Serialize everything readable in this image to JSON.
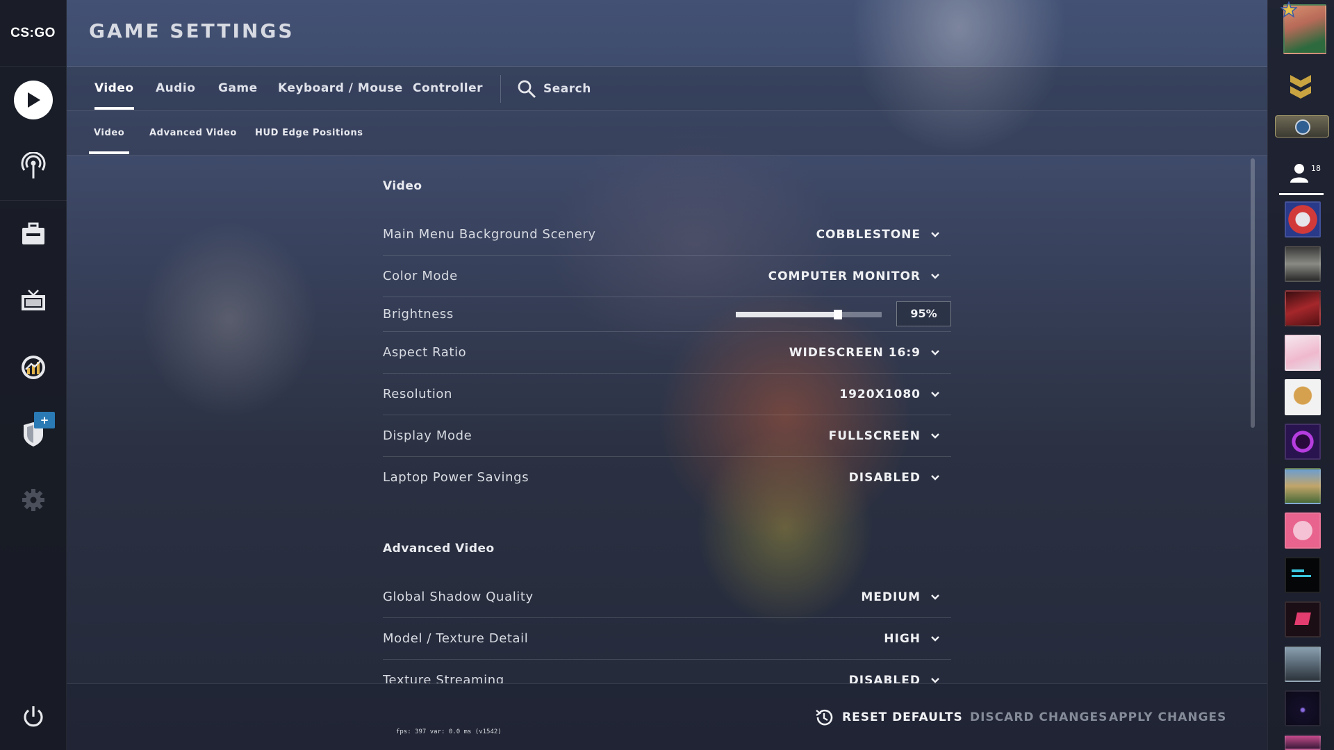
{
  "app": {
    "logo_text": "CS:GO",
    "page_title": "GAME SETTINGS"
  },
  "tabs": [
    {
      "label": "Video",
      "active": true
    },
    {
      "label": "Audio",
      "active": false
    },
    {
      "label": "Game",
      "active": false
    },
    {
      "label": "Keyboard / Mouse",
      "active": false
    },
    {
      "label": "Controller",
      "active": false
    }
  ],
  "search": {
    "label": "Search"
  },
  "subtabs": [
    {
      "label": "Video",
      "active": true
    },
    {
      "label": "Advanced Video",
      "active": false
    },
    {
      "label": "HUD Edge Positions",
      "active": false
    }
  ],
  "sections": {
    "video_title": "Video",
    "advanced_title": "Advanced Video"
  },
  "settings": {
    "background_scenery": {
      "label": "Main Menu Background Scenery",
      "value": "COBBLESTONE"
    },
    "color_mode": {
      "label": "Color Mode",
      "value": "COMPUTER MONITOR"
    },
    "brightness": {
      "label": "Brightness",
      "value": "95%",
      "slider_level": 0.7
    },
    "aspect_ratio": {
      "label": "Aspect Ratio",
      "value": "WIDESCREEN 16:9"
    },
    "resolution": {
      "label": "Resolution",
      "value": "1920X1080"
    },
    "display_mode": {
      "label": "Display Mode",
      "value": "FULLSCREEN"
    },
    "power_savings": {
      "label": "Laptop Power Savings",
      "value": "DISABLED"
    },
    "shadow_quality": {
      "label": "Global Shadow Quality",
      "value": "MEDIUM"
    },
    "texture_detail": {
      "label": "Model / Texture Detail",
      "value": "HIGH"
    },
    "texture_streaming": {
      "label": "Texture Streaming",
      "value": "DISABLED"
    }
  },
  "bottom": {
    "reset": "RESET DEFAULTS",
    "discard": "DISCARD CHANGES",
    "apply": "APPLY CHANGES",
    "fps_text": "fps:   397 var:  0.0 ms (v1542)"
  },
  "friends": {
    "count": "18"
  },
  "nav_left": {
    "icons": [
      "play-icon",
      "broadcast-icon",
      "inventory-icon",
      "tv-icon",
      "stats-icon",
      "shield-icon",
      "gear-icon",
      "power-icon"
    ],
    "badge": "+"
  },
  "colors": {
    "accent": "#ffffff",
    "badge_blue": "#2a7ab5",
    "dim_button": "#8a90a0"
  }
}
